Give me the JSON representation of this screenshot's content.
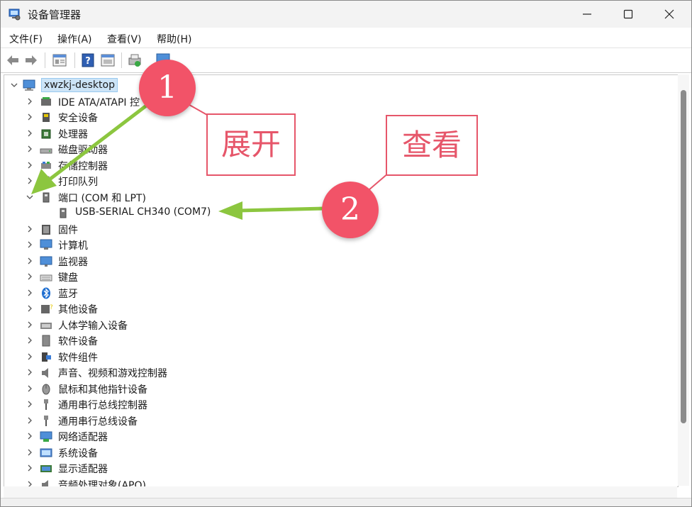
{
  "window": {
    "title": "设备管理器"
  },
  "menu": [
    "文件(F)",
    "操作(A)",
    "查看(V)",
    "帮助(H)"
  ],
  "toolbar_icons": [
    "back-arrow-icon",
    "forward-arrow-icon",
    "properties-icon",
    "help-icon",
    "view-icon",
    "scan-hardware-icon",
    "monitor-icon"
  ],
  "tree": {
    "root": "xwzkj-desktop",
    "items": [
      {
        "label": "IDE ATA/ATAPI 控",
        "icon": "ide-controller-icon",
        "expanded": false
      },
      {
        "label": "安全设备",
        "icon": "security-device-icon",
        "expanded": false
      },
      {
        "label": "处理器",
        "icon": "processor-icon",
        "expanded": false
      },
      {
        "label": "磁盘驱动器",
        "icon": "disk-drive-icon",
        "expanded": false
      },
      {
        "label": "存储控制器",
        "icon": "storage-controller-icon",
        "expanded": false
      },
      {
        "label": "打印队列",
        "icon": "print-queue-icon",
        "expanded": false
      },
      {
        "label": "端口 (COM 和 LPT)",
        "icon": "port-icon",
        "expanded": true
      },
      {
        "label": "USB-SERIAL CH340 (COM7)",
        "icon": "port-icon",
        "child": true
      },
      {
        "label": "固件",
        "icon": "firmware-icon",
        "expanded": false
      },
      {
        "label": "计算机",
        "icon": "computer-icon",
        "expanded": false
      },
      {
        "label": "监视器",
        "icon": "monitor-icon",
        "expanded": false
      },
      {
        "label": "键盘",
        "icon": "keyboard-icon",
        "expanded": false
      },
      {
        "label": "蓝牙",
        "icon": "bluetooth-icon",
        "expanded": false
      },
      {
        "label": "其他设备",
        "icon": "other-devices-icon",
        "expanded": false
      },
      {
        "label": "人体学输入设备",
        "icon": "hid-icon",
        "expanded": false
      },
      {
        "label": "软件设备",
        "icon": "software-device-icon",
        "expanded": false
      },
      {
        "label": "软件组件",
        "icon": "software-component-icon",
        "expanded": false
      },
      {
        "label": "声音、视频和游戏控制器",
        "icon": "sound-icon",
        "expanded": false
      },
      {
        "label": "鼠标和其他指针设备",
        "icon": "mouse-icon",
        "expanded": false
      },
      {
        "label": "通用串行总线控制器",
        "icon": "usb-icon",
        "expanded": false
      },
      {
        "label": "通用串行总线设备",
        "icon": "usb-icon",
        "expanded": false
      },
      {
        "label": "网络适配器",
        "icon": "network-adapter-icon",
        "expanded": false
      },
      {
        "label": "系统设备",
        "icon": "system-device-icon",
        "expanded": false
      },
      {
        "label": "显示适配器",
        "icon": "display-adapter-icon",
        "expanded": false
      },
      {
        "label": "音频处理对象(APO)",
        "icon": "audio-processing-icon",
        "expanded": false
      }
    ]
  },
  "annotations": [
    {
      "number": "1",
      "text": "展开"
    },
    {
      "number": "2",
      "text": "查看"
    }
  ],
  "colors": {
    "annotation_red": "#f25368",
    "arrow_green": "#8cc63f",
    "selection": "#cce4f7"
  }
}
